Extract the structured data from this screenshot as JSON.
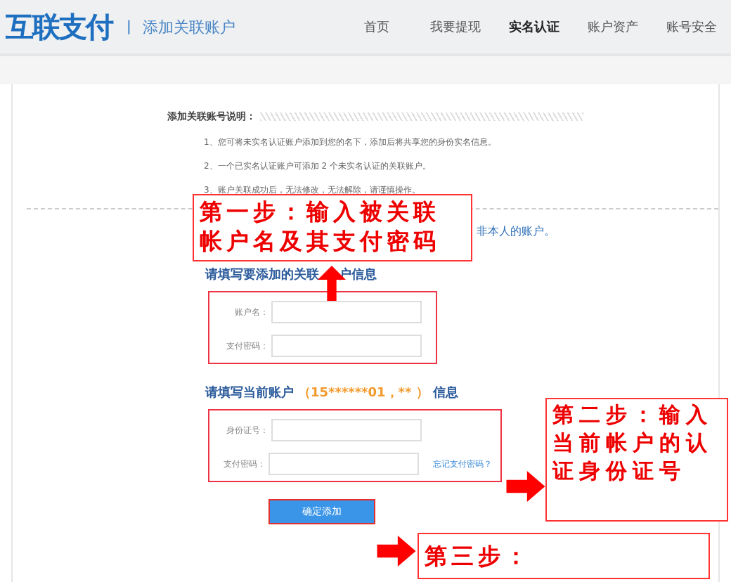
{
  "header": {
    "logo": "互联支付",
    "separator": "|",
    "page_title": "添加关联账户",
    "nav": [
      {
        "label": "首页",
        "selected": false
      },
      {
        "label": "我要提现",
        "selected": false
      },
      {
        "label": "实名认证",
        "selected": true
      },
      {
        "label": "账户资产",
        "selected": false
      },
      {
        "label": "账号安全",
        "selected": false
      }
    ]
  },
  "notes": {
    "title": "添加关联账号说明：",
    "items": [
      "1、您可将未实名认证账户添加到您的名下，添加后将共享您的身份实名信息。",
      "2、一个已实名认证账户可添加 2 个未实名认证的关联账户。",
      "3、账户关联成功后，无法修改，无法解除，请谨慎操作。"
    ],
    "hint": "非本人的账户。"
  },
  "section_related": {
    "heading_start": "请填写要添加的关联",
    "heading_end": "户信息",
    "fields": [
      {
        "label": "账户名："
      },
      {
        "label": "支付密码："
      }
    ]
  },
  "section_current": {
    "heading_prefix": "请填写当前账户",
    "account": "（15******01，**  ）",
    "heading_suffix": "信息",
    "fields": [
      {
        "label": "身份证号："
      },
      {
        "label": "支付密码：",
        "link": "忘记支付密码？"
      }
    ]
  },
  "submit": "确定添加",
  "annotations": [
    {
      "kind": "up",
      "text": "第一步：输入被关联帐户名及其支付密码"
    },
    {
      "kind": "right",
      "text": "第二步：输入当前帐户的认证身份证号"
    },
    {
      "kind": "right",
      "text": "第三步："
    }
  ]
}
